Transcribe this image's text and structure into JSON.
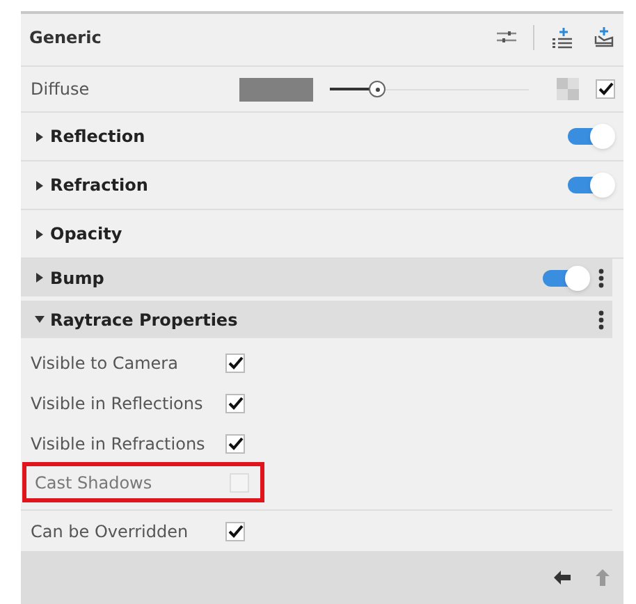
{
  "header": {
    "title": "Generic"
  },
  "diffuse": {
    "label": "Diffuse",
    "color": "#808080",
    "level": 0.24,
    "checked": true
  },
  "sections": [
    {
      "title": "Reflection",
      "expanded": false,
      "toggle": true,
      "menu": false,
      "shaded": false
    },
    {
      "title": "Refraction",
      "expanded": false,
      "toggle": true,
      "menu": false,
      "shaded": false
    },
    {
      "title": "Opacity",
      "expanded": false,
      "menu": false,
      "shaded": false
    },
    {
      "title": "Bump",
      "expanded": false,
      "toggle": true,
      "menu": true,
      "shaded": true
    },
    {
      "title": "Raytrace Properties",
      "expanded": true,
      "menu": true,
      "shaded": true
    }
  ],
  "properties": [
    {
      "label": "Visible to Camera",
      "checked": true,
      "highlighted": false
    },
    {
      "label": "Visible in Reflections",
      "checked": true,
      "highlighted": false
    },
    {
      "label": "Visible in Refractions",
      "checked": true,
      "highlighted": false
    },
    {
      "label": "Cast Shadows",
      "checked": false,
      "highlighted": true
    }
  ],
  "override": {
    "label": "Can be Overridden",
    "checked": true
  }
}
